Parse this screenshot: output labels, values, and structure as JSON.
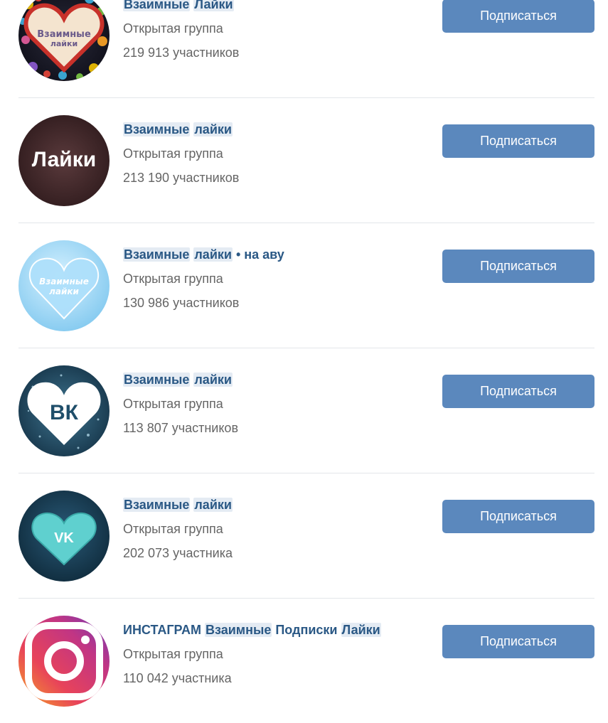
{
  "groups": [
    {
      "name_parts": [
        {
          "t": "Взаимные",
          "h": true
        },
        {
          "t": " ",
          "h": false
        },
        {
          "t": "Лайки",
          "h": true
        }
      ],
      "kind": "Открытая группа",
      "members": "219 913 участников",
      "button": "Подписаться",
      "avatar": "hearts-collage",
      "avatar_text": [
        "Взаимные",
        "лайки"
      ]
    },
    {
      "name_parts": [
        {
          "t": "Взаимные",
          "h": true
        },
        {
          "t": " ",
          "h": false
        },
        {
          "t": "лайки",
          "h": true
        }
      ],
      "kind": "Открытая группа",
      "members": "213 190 участников",
      "button": "Подписаться",
      "avatar": "dark-text",
      "avatar_text": [
        "Лайки"
      ]
    },
    {
      "name_parts": [
        {
          "t": "Взаимные",
          "h": true
        },
        {
          "t": " ",
          "h": false
        },
        {
          "t": "лайки",
          "h": true
        },
        {
          "t": " • на аву",
          "h": false
        }
      ],
      "kind": "Открытая группа",
      "members": "130 986 участников",
      "button": "Подписаться",
      "avatar": "light-heart",
      "avatar_text": [
        "Взаимные",
        "лайки"
      ]
    },
    {
      "name_parts": [
        {
          "t": "Взаимные",
          "h": true
        },
        {
          "t": " ",
          "h": false
        },
        {
          "t": "лайки",
          "h": true
        }
      ],
      "kind": "Открытая группа",
      "members": "113 807 участников",
      "button": "Подписаться",
      "avatar": "vk-heart",
      "avatar_text": [
        "ВК"
      ]
    },
    {
      "name_parts": [
        {
          "t": "Взаимные",
          "h": true
        },
        {
          "t": " ",
          "h": false
        },
        {
          "t": "лайки",
          "h": true
        }
      ],
      "kind": "Открытая группа",
      "members": "202 073 участника",
      "button": "Подписаться",
      "avatar": "vk-logo-heart",
      "avatar_text": [
        "VK"
      ]
    },
    {
      "name_parts": [
        {
          "t": "ИНСТАГРАМ ",
          "h": false
        },
        {
          "t": "Взаимные",
          "h": true
        },
        {
          "t": " Подписки ",
          "h": false
        },
        {
          "t": "Лайки",
          "h": true
        }
      ],
      "kind": "Открытая группа",
      "members": "110 042 участника",
      "button": "Подписаться",
      "avatar": "instagram",
      "avatar_text": []
    }
  ],
  "colors": {
    "link": "#2a5885",
    "button": "#5b88bd",
    "highlight": "#e4ebf3",
    "secondary_text": "#656565",
    "divider": "#e3e6ea"
  }
}
